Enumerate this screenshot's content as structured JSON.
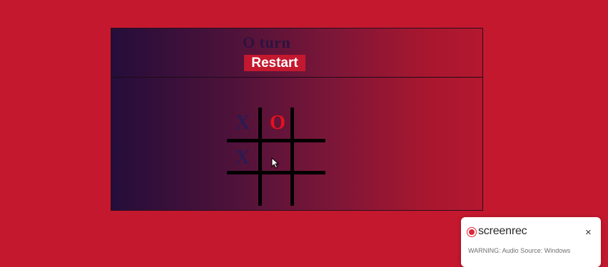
{
  "header": {
    "turn_text": "O turn",
    "restart_label": "Restart"
  },
  "board": {
    "cells": [
      "X",
      "O",
      "",
      "X",
      "",
      "",
      "",
      "",
      ""
    ],
    "x_color": "#2c1a52",
    "o_color": "#e8101e"
  },
  "recorder": {
    "logo_text": "screenrec",
    "close_symbol": "×",
    "subtext": "WARNING: Audio Source: Windows"
  },
  "colors": {
    "background": "#c4182e",
    "restart_button": "#c4182e",
    "grid": "#000000"
  }
}
